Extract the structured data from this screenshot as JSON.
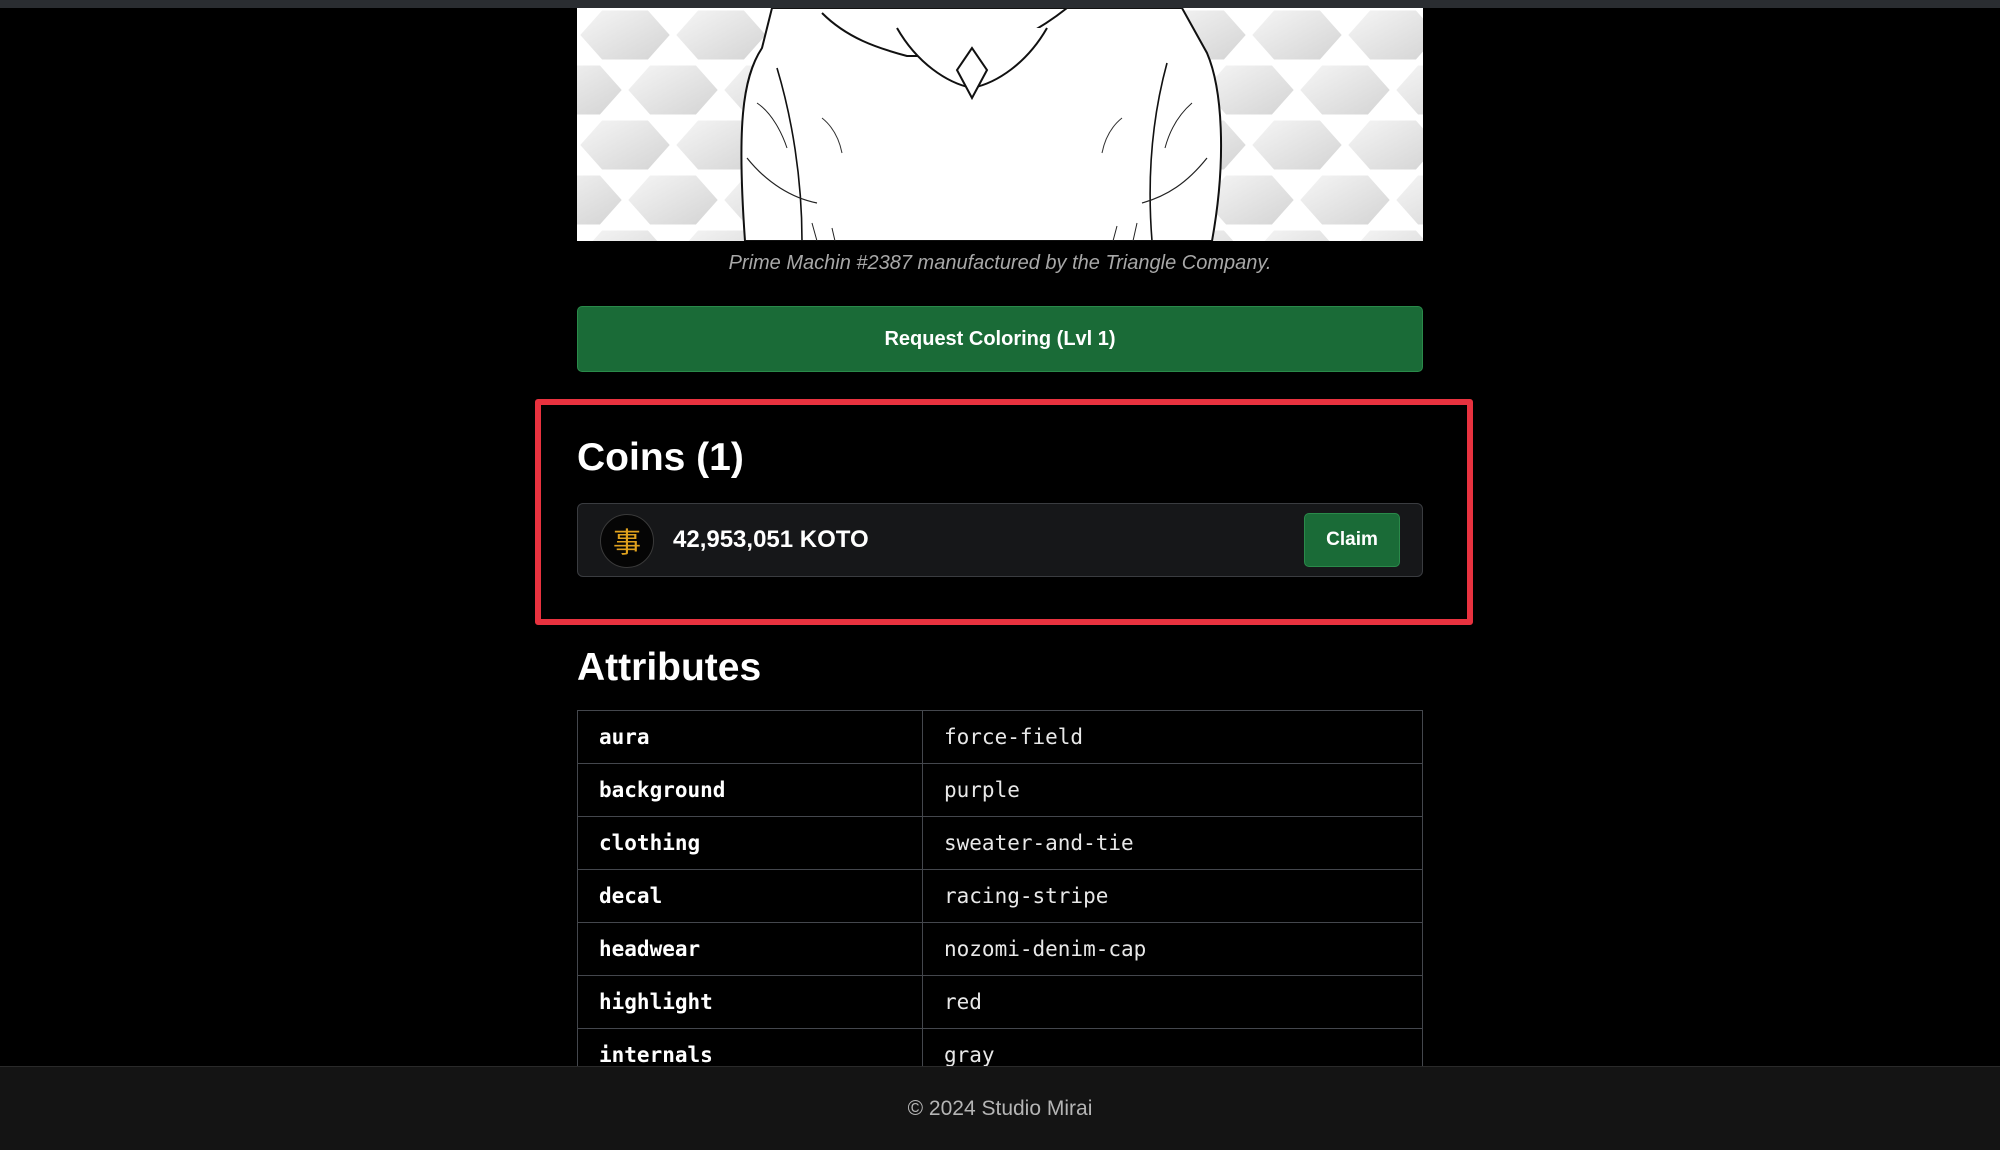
{
  "artwork": {
    "caption": "Prime Machin #2387 manufactured by the Triangle Company."
  },
  "actions": {
    "request_coloring_label": "Request Coloring (Lvl 1)"
  },
  "coins": {
    "title": "Coins (1)",
    "items": [
      {
        "icon_glyph": "事",
        "amount": "42,953,051 KOTO",
        "claim_label": "Claim"
      }
    ]
  },
  "attributes": {
    "title": "Attributes",
    "rows": [
      {
        "key": "aura",
        "value": "force-field"
      },
      {
        "key": "background",
        "value": "purple"
      },
      {
        "key": "clothing",
        "value": "sweater-and-tie"
      },
      {
        "key": "decal",
        "value": "racing-stripe"
      },
      {
        "key": "headwear",
        "value": "nozomi-denim-cap"
      },
      {
        "key": "highlight",
        "value": "red"
      },
      {
        "key": "internals",
        "value": "gray"
      }
    ]
  },
  "footer": {
    "text": "© 2024 Studio Mirai"
  },
  "colors": {
    "background": "#000000",
    "button_green": "#1a6b37",
    "highlight_red": "#e8323f",
    "coin_gold": "#e0a21e"
  }
}
